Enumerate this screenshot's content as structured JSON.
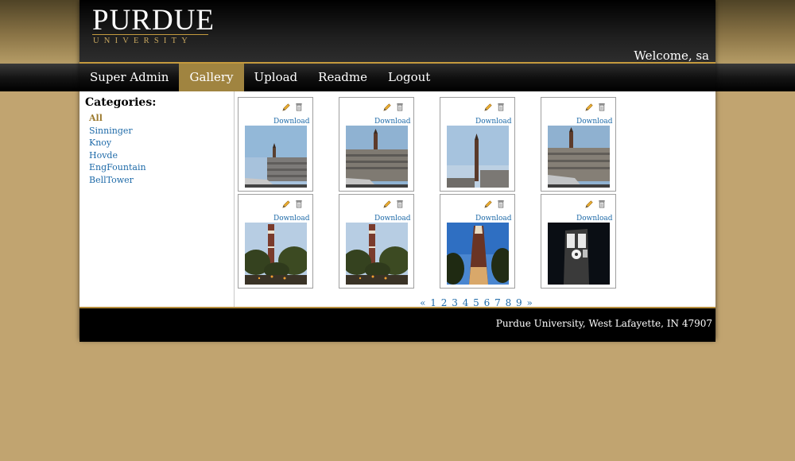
{
  "header": {
    "logo_main": "PURDUE",
    "logo_sub": "UNIVERSITY",
    "welcome": "Welcome, sa"
  },
  "nav": {
    "items": [
      "Super Admin",
      "Gallery",
      "Upload",
      "Readme",
      "Logout"
    ],
    "active": "Gallery"
  },
  "sidebar": {
    "heading": "Categories:",
    "categories": [
      "All",
      "Sinninger",
      "Knoy",
      "Hovde",
      "EngFountain",
      "BellTower"
    ],
    "active": "All"
  },
  "gallery": {
    "download_label": "Download",
    "edit_icon": "pencil-icon",
    "delete_icon": "trash-icon",
    "images": [
      {
        "subject": "bell tower with building",
        "scene": "day"
      },
      {
        "subject": "bell tower with building",
        "scene": "day"
      },
      {
        "subject": "bell tower spire",
        "scene": "dusk"
      },
      {
        "subject": "bell tower with building",
        "scene": "day"
      },
      {
        "subject": "bell tower with trees",
        "scene": "evening"
      },
      {
        "subject": "bell tower with trees",
        "scene": "evening"
      },
      {
        "subject": "bell tower from below",
        "scene": "blue-sky"
      },
      {
        "subject": "clock tower",
        "scene": "night"
      }
    ]
  },
  "pagination": {
    "prev": "«",
    "pages": [
      "1",
      "2",
      "3",
      "4",
      "5",
      "6",
      "7",
      "8",
      "9"
    ],
    "next": "»"
  },
  "footer": {
    "text": "Purdue University, West Lafayette, IN 47907"
  },
  "colors": {
    "gold": "#c49a3e",
    "nav_active": "#a08440",
    "link": "#1e6aa8",
    "page_bg": "#c1a470"
  }
}
